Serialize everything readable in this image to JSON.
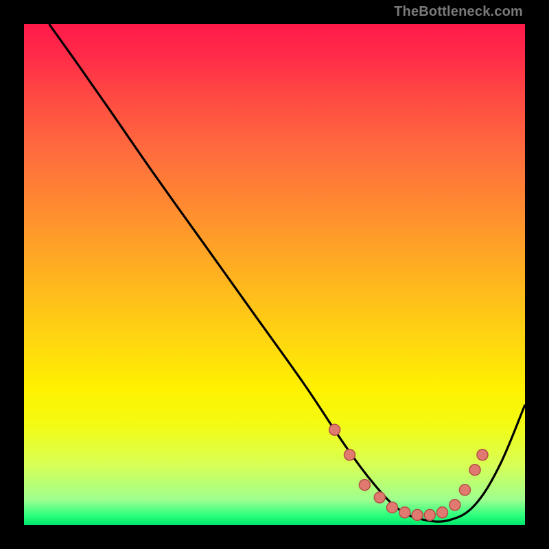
{
  "watermark": "TheBottleneck.com",
  "colors": {
    "dot_fill": "#e07a70",
    "dot_stroke": "#b54c45",
    "line": "#000000"
  },
  "chart_data": {
    "type": "line",
    "title": "",
    "xlabel": "",
    "ylabel": "",
    "xlim": [
      0,
      100
    ],
    "ylim": [
      0,
      100
    ],
    "series": [
      {
        "name": "bottleneck-curve",
        "x": [
          5,
          10,
          17,
          26,
          36,
          46,
          56,
          64,
          70,
          75,
          80,
          85,
          90,
          95,
          100
        ],
        "y": [
          100,
          93,
          83,
          70,
          56,
          42,
          28,
          16,
          8,
          3,
          1,
          1,
          4,
          12,
          24
        ]
      }
    ],
    "markers": {
      "name": "highlight-dots",
      "x": [
        62,
        65,
        68,
        71,
        73.5,
        76,
        78.5,
        81,
        83.5,
        86,
        88,
        90,
        91.5
      ],
      "y": [
        19,
        14,
        8,
        5.5,
        3.5,
        2.5,
        2,
        2,
        2.5,
        4,
        7,
        11,
        14
      ]
    }
  }
}
